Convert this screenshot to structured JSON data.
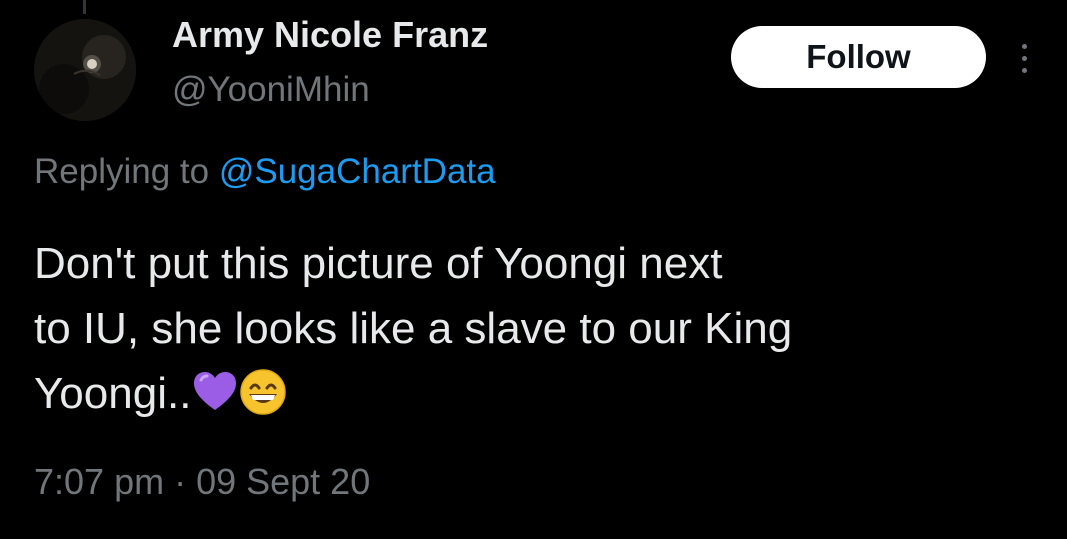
{
  "author": {
    "display_name": "Army Nicole Franz",
    "handle": "@YooniMhin"
  },
  "actions": {
    "follow_label": "Follow",
    "more_icon": "more-vertical-icon"
  },
  "reply_context": {
    "prefix": "Replying to ",
    "mention": "@SugaChartData"
  },
  "tweet": {
    "lines": [
      "Don't put this picture of Yoongi next",
      "to IU, she looks like a slave to our King",
      "Yoongi.."
    ],
    "emojis": [
      "purple-heart-icon",
      "grinning-face-icon"
    ]
  },
  "meta": {
    "timestamp": "7:07 pm · 09 Sept 20"
  },
  "colors": {
    "background": "#000000",
    "primary_text": "#e7e9ea",
    "secondary_text": "#71767b",
    "link": "#1d9bf0",
    "follow_bg": "#ffffff"
  }
}
